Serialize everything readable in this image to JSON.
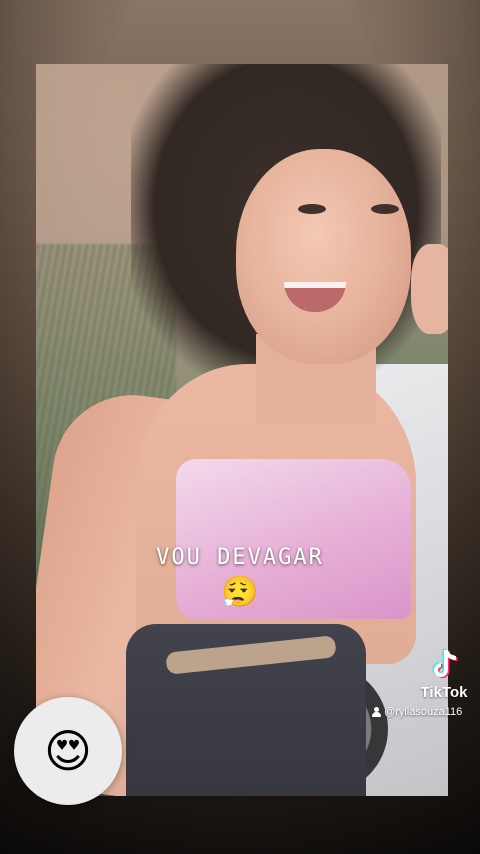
{
  "caption": {
    "text": "VOU DEVAGAR",
    "emoji": "😮‍💨"
  },
  "reaction": {
    "emoji": "😍"
  },
  "watermark": {
    "brand": "TikTok",
    "username": "@ryllasouza116",
    "logo_icon": "tiktok-note-icon",
    "user_icon": "person-icon"
  },
  "colors": {
    "caption_text": "#ffffff",
    "reaction_bubble": "#ececec",
    "tiktok_cyan": "#25f4ee",
    "tiktok_red": "#fe2c55"
  }
}
